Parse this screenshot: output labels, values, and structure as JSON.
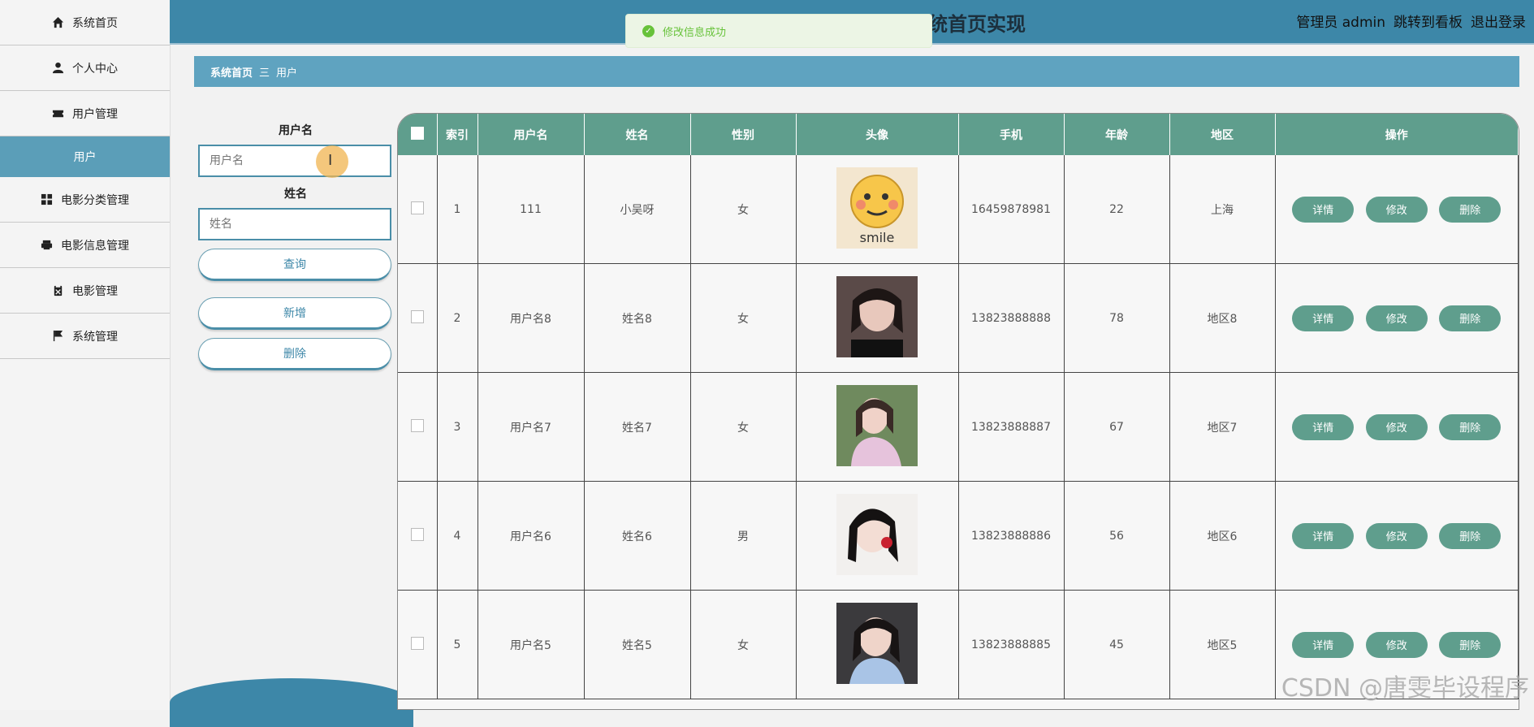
{
  "header": {
    "title": "系统首页实现",
    "admin": "管理员 admin",
    "dashboard_link": "跳转到看板",
    "logout": "退出登录"
  },
  "toast": {
    "message": "修改信息成功"
  },
  "sidebar": {
    "items": [
      {
        "label": "系统首页",
        "icon": "home-icon"
      },
      {
        "label": "个人中心",
        "icon": "user-icon"
      },
      {
        "label": "用户管理",
        "icon": "ticket-icon"
      },
      {
        "label": "用户",
        "sub": true
      },
      {
        "label": "电影分类管理",
        "icon": "grid-icon"
      },
      {
        "label": "电影信息管理",
        "icon": "printer-icon"
      },
      {
        "label": "电影管理",
        "icon": "clipboard-icon"
      },
      {
        "label": "系统管理",
        "icon": "flag-icon"
      }
    ]
  },
  "breadcrumb": {
    "home": "系统首页",
    "separator": "三",
    "current": "用户"
  },
  "search": {
    "username_label": "用户名",
    "username_placeholder": "用户名",
    "name_label": "姓名",
    "name_placeholder": "姓名",
    "query": "查询",
    "add": "新增",
    "delete": "删除"
  },
  "table": {
    "columns": [
      "索引",
      "用户名",
      "姓名",
      "性别",
      "头像",
      "手机",
      "年龄",
      "地区",
      "操作"
    ],
    "actions": {
      "detail": "详情",
      "edit": "修改",
      "delete": "删除"
    },
    "rows": [
      {
        "index": "1",
        "username": "111",
        "name": "小吴呀",
        "gender": "女",
        "avatar": "smile-face",
        "phone": "16459878981",
        "age": "22",
        "region": "上海"
      },
      {
        "index": "2",
        "username": "用户名8",
        "name": "姓名8",
        "gender": "女",
        "avatar": "photo-dark",
        "phone": "13823888888",
        "age": "78",
        "region": "地区8"
      },
      {
        "index": "3",
        "username": "用户名7",
        "name": "姓名7",
        "gender": "女",
        "avatar": "photo-pink",
        "phone": "13823888887",
        "age": "67",
        "region": "地区7"
      },
      {
        "index": "4",
        "username": "用户名6",
        "name": "姓名6",
        "gender": "男",
        "avatar": "photo-light",
        "phone": "13823888886",
        "age": "56",
        "region": "地区6"
      },
      {
        "index": "5",
        "username": "用户名5",
        "name": "姓名5",
        "gender": "女",
        "avatar": "photo-blue",
        "phone": "13823888885",
        "age": "45",
        "region": "地区5"
      }
    ]
  },
  "watermark": "CSDN @唐雯毕设程序",
  "colors": {
    "header": "#3d87a8",
    "accent": "#5f9e8d",
    "breadcrumb": "#5fa3c0",
    "toast": "#67c23a"
  }
}
